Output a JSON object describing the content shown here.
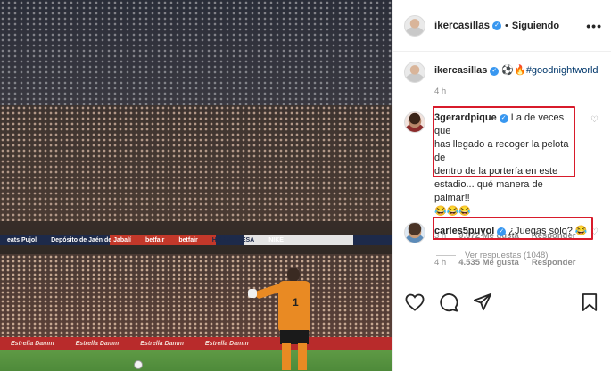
{
  "post": {
    "author": "ikercasillas",
    "follow_status": "Siguiendo",
    "separator": "•",
    "more_glyph": "•••"
  },
  "photo": {
    "ads": {
      "row_a": [
        "eats Pujol",
        "Depósito de Jaén de Jabalí",
        "betfair",
        "betfair",
        "HORMIPRESA",
        "NIKE"
      ],
      "row_b": [
        "Estrella Damm",
        "Estrella Damm",
        "Estrella Damm",
        "Estrella Damm"
      ]
    },
    "jersey_number": "1"
  },
  "caption": {
    "username": "ikercasillas",
    "text": "⚽🔥",
    "hashtag": "#goodnightworld",
    "time": "4 h"
  },
  "comments": [
    {
      "username": "3gerardpique",
      "text": "La de veces que has llegado a recoger la pelota de dentro de la portería en este estadio... qué manera de palmar!! 😂😂😂",
      "lines": [
        "La de veces que",
        "has llegado a recoger la pelota de",
        "dentro de la portería en este",
        "estadio... qué manera de palmar!!",
        "😂😂😂"
      ],
      "time": "3 h",
      "likes": "9.672 Me gusta",
      "reply": "Responder",
      "view_replies": "Ver respuestas (1048)"
    },
    {
      "username": "carles5puyol",
      "text": "¿Juegas sólo? 😂",
      "time": "4 h",
      "likes": "4.535 Me gusta",
      "reply": "Responder"
    }
  ],
  "icons": {
    "verified": "verified-badge-icon",
    "like": "heart-icon",
    "comment": "comment-icon",
    "share": "share-icon",
    "save": "bookmark-icon"
  },
  "colors": {
    "verified": "#3897f0",
    "highlight": "#d81b2b",
    "hashtag": "#00376b",
    "secondary_text": "#8e8e8e"
  }
}
